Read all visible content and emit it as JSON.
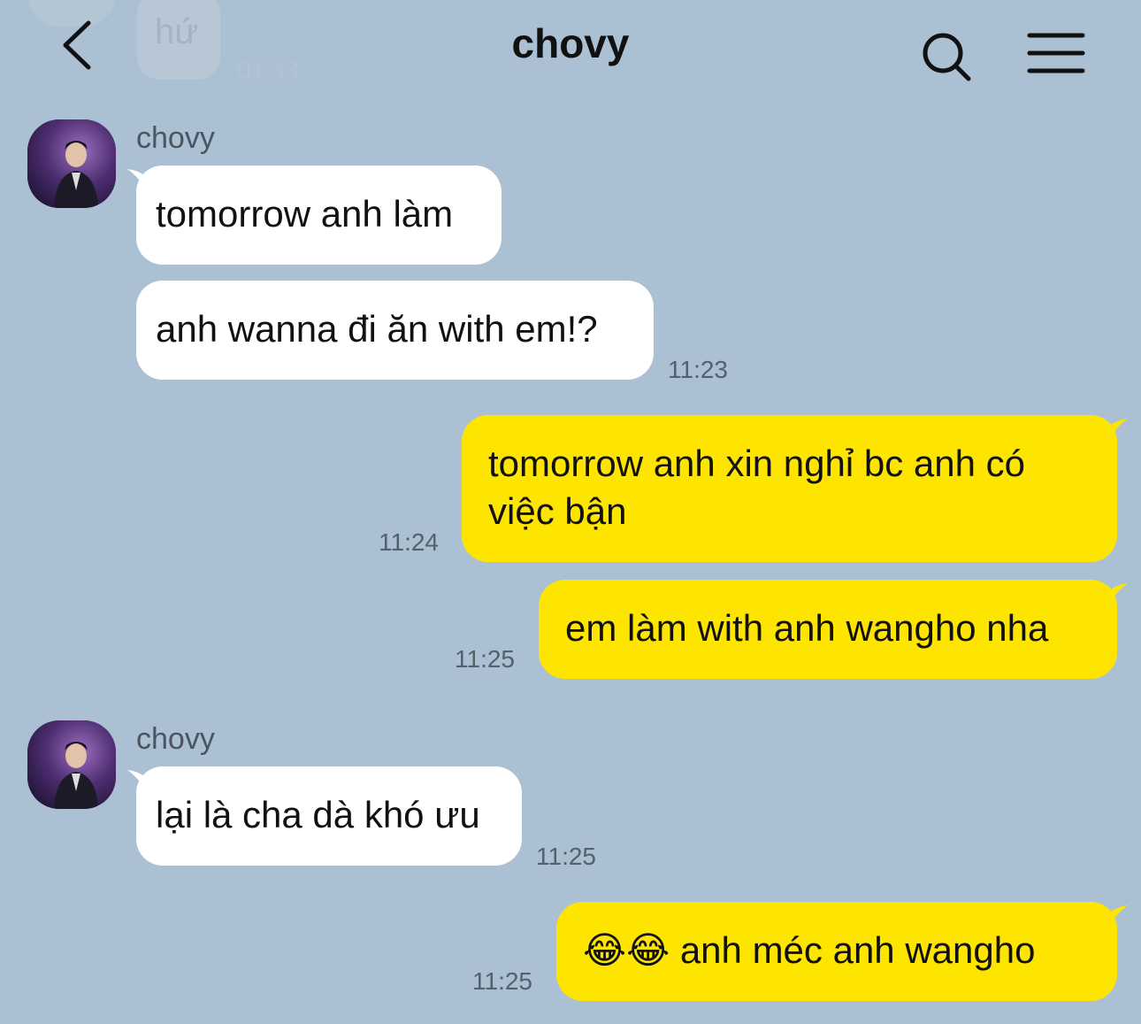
{
  "previous_message": {
    "text": "hứ",
    "time": "01:43"
  },
  "header": {
    "title": "chovy"
  },
  "messages": [
    {
      "sender": "chovy"
    },
    {
      "text": "tomorrow anh làm"
    },
    {
      "text": "anh wanna đi ăn with em!?",
      "time": "11:23"
    },
    {
      "line1": "tomorrow anh xin nghỉ bc anh có",
      "line2": "việc bận",
      "time": "11:24"
    },
    {
      "text": "em làm with anh wangho nha",
      "time": "11:25"
    },
    {
      "sender": "chovy"
    },
    {
      "text": "lại là cha dà khó ưu",
      "time": "11:25"
    },
    {
      "emoji": "😂😂",
      "text": "anh méc anh wangho",
      "time": "11:25"
    }
  ],
  "colors": {
    "background": "#abc1d3",
    "incoming_bubble": "#ffffff",
    "outgoing_bubble": "#fee500"
  }
}
